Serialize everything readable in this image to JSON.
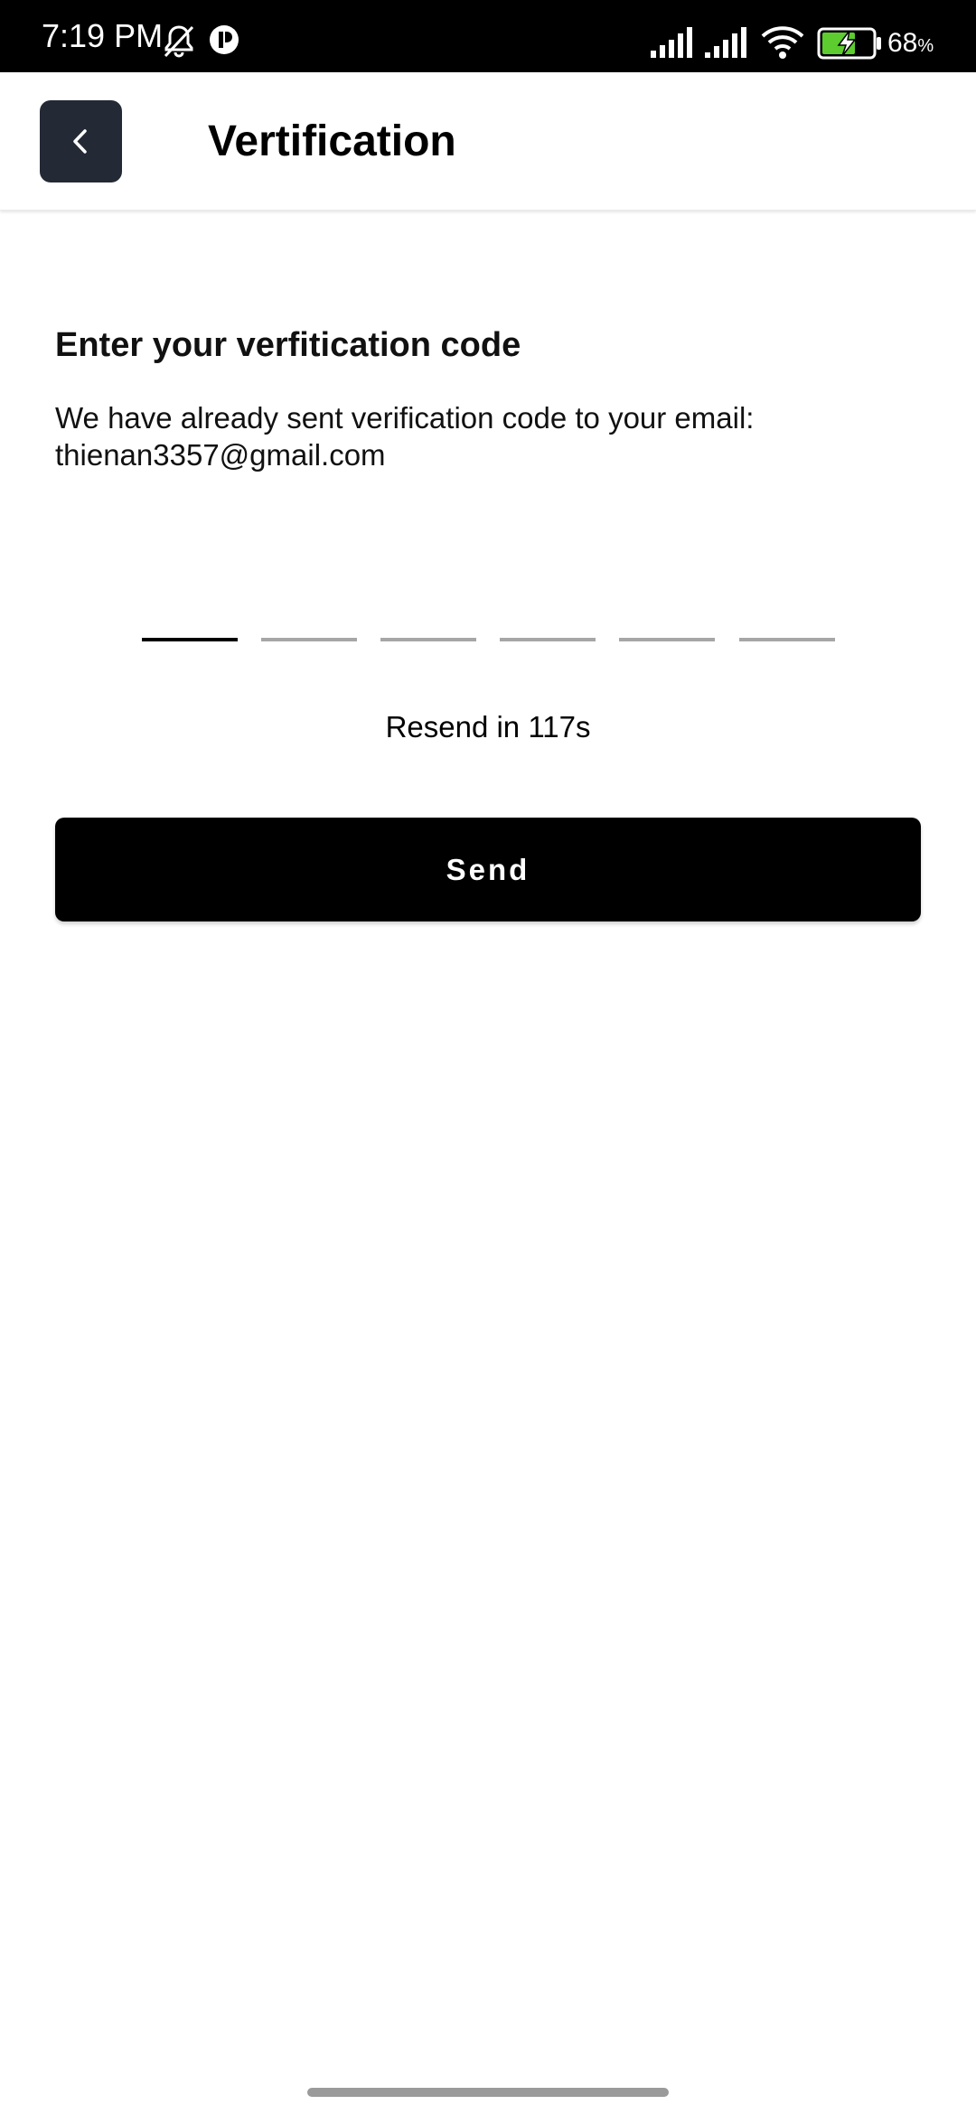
{
  "status_bar": {
    "time": "7:19 PM",
    "battery_percent": "68",
    "battery_unit": "%",
    "icons": [
      "bell-off-icon",
      "app-notification-icon",
      "signal-icon",
      "signal-icon",
      "wifi-icon",
      "battery-charging-icon"
    ]
  },
  "app_bar": {
    "title": "Vertification",
    "back_icon": "chevron-left-icon"
  },
  "content": {
    "heading": "Enter your verfitication code",
    "description_line1": "We have already sent verification code to your email:",
    "email": "thienan3357@gmail.com",
    "otp": {
      "length": 6,
      "active_index": 0,
      "values": [
        "",
        "",
        "",
        "",
        "",
        ""
      ]
    },
    "resend_text": "Resend in 117s",
    "send_label": "Send"
  },
  "colors": {
    "status_bar_bg": "#000000",
    "back_button_bg": "#232a35",
    "primary_button_bg": "#000000",
    "otp_inactive": "#a6a6a6",
    "otp_active": "#000000",
    "battery_charge": "#5ccc2e"
  }
}
